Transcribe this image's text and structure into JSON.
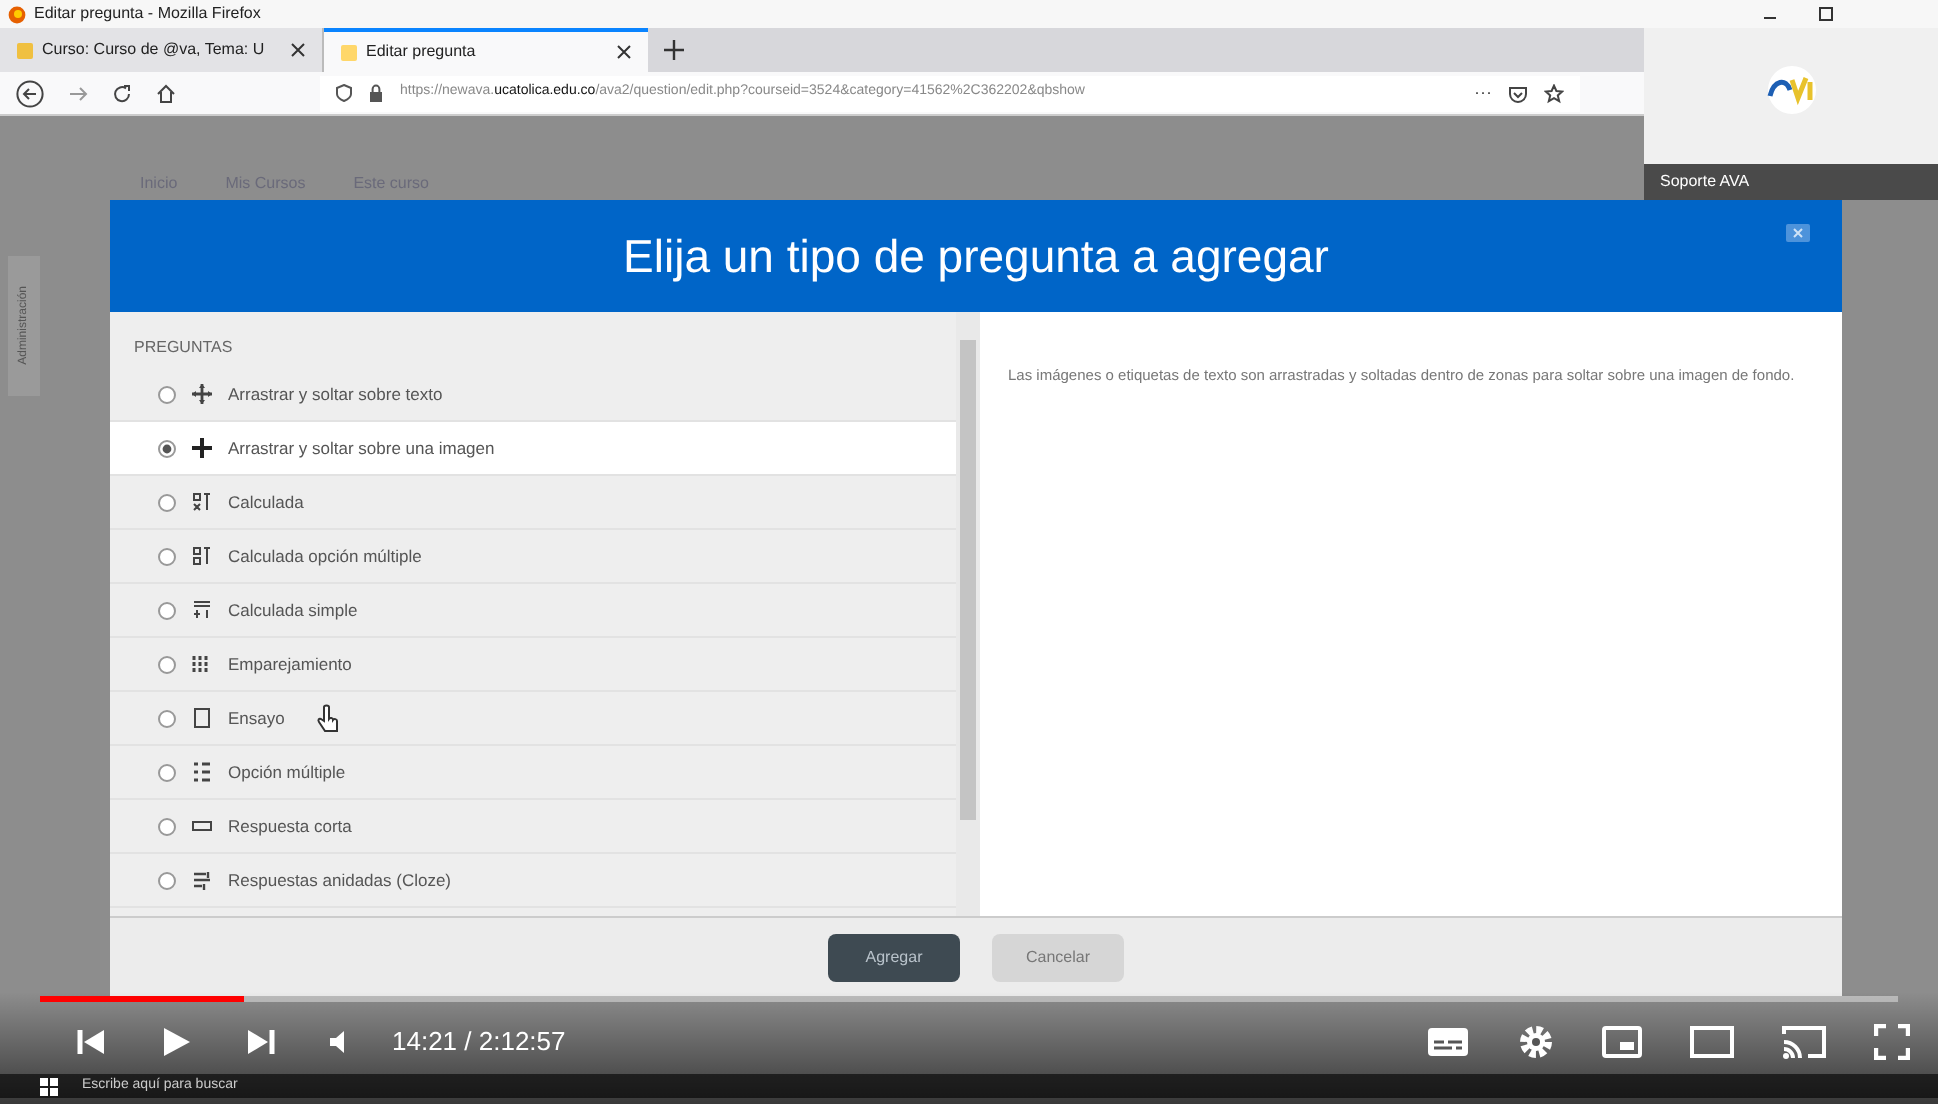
{
  "window": {
    "title": "Editar pregunta - Mozilla Firefox"
  },
  "tabs": [
    {
      "label": "Curso: Curso de @va, Tema: U",
      "selected": false
    },
    {
      "label": "Editar pregunta",
      "selected": true
    }
  ],
  "address_bar": {
    "url_prefix": "https://newava.",
    "url_domain": "ucatolica.edu.co",
    "url_rest": "/ava2/question/edit.php?courseid=3524&category=41562%2C362202&qbshow",
    "more": "···"
  },
  "site_nav": [
    "Inicio",
    "Mis Cursos",
    "Este curso"
  ],
  "side_tab": "Administración",
  "popup": {
    "label": "Soporte AVA"
  },
  "modal": {
    "title": "Elija un tipo de pregunta a agregar",
    "section": "PREGUNTAS",
    "options": [
      {
        "label": "Arrastrar y soltar sobre texto",
        "selected": false
      },
      {
        "label": "Arrastrar y soltar sobre una imagen",
        "selected": true
      },
      {
        "label": "Calculada",
        "selected": false
      },
      {
        "label": "Calculada opción múltiple",
        "selected": false
      },
      {
        "label": "Calculada simple",
        "selected": false
      },
      {
        "label": "Emparejamiento",
        "selected": false
      },
      {
        "label": "Ensayo",
        "selected": false
      },
      {
        "label": "Opción múltiple",
        "selected": false
      },
      {
        "label": "Respuesta corta",
        "selected": false
      },
      {
        "label": "Respuestas anidadas (Cloze)",
        "selected": false
      }
    ],
    "description": "Las imágenes o etiquetas de texto son arrastradas y soltadas dentro de zonas para soltar sobre una imagen de fondo.",
    "buttons": [
      "Agregar",
      "Cancelar"
    ]
  },
  "player": {
    "level": 0.11,
    "time": "14:21 / 2:12:57"
  },
  "taskbar": {
    "search": "Escribe aquí para buscar"
  }
}
